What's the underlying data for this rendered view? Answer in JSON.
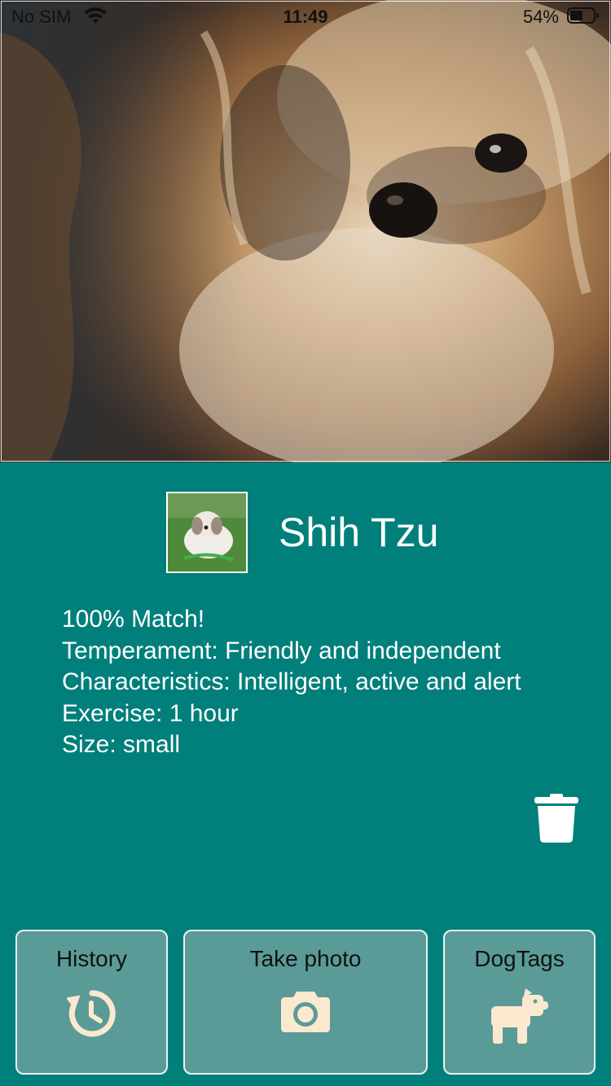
{
  "status_bar": {
    "carrier": "No SIM",
    "time": "11:49",
    "battery": "54%",
    "battery_level": 0.54
  },
  "result": {
    "breed": "Shih Tzu",
    "details": [
      "100% Match!",
      "Temperament: Friendly and independent",
      "Characteristics: Intelligent, active and alert",
      "Exercise: 1 hour",
      "Size: small"
    ]
  },
  "icons": {
    "trash": "trash-icon",
    "history": "history-icon",
    "camera": "camera-icon",
    "dog": "dog-icon",
    "wifi": "wifi-icon",
    "battery": "battery-icon"
  },
  "toolbar": {
    "history_label": "History",
    "photo_label": "Take photo",
    "dogtags_label": "DogTags"
  },
  "colors": {
    "background": "#007f7b",
    "button_fill": "#5a9b98",
    "icon_cream": "#fbe9cf"
  }
}
